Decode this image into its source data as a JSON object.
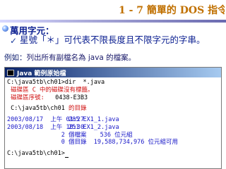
{
  "slide": {
    "title": "1 - 7   簡單的 DOS 指令",
    "heading": "萬用字元：",
    "sub_bullet": "✓",
    "sub_text": "星號「＊」可代表不限長度且不限字元的字串。",
    "example_label": "例如：",
    "example_text": "列出所有副檔名為  java  的檔案。"
  },
  "window": {
    "title": "Java 範例原始檔"
  },
  "console": {
    "cmd": "C:\\java5tb\\ch01>dir  *.java",
    "vol_note": " 磁碟區 C 中的磁碟沒有標籤。",
    "serial_label": " 磁碟區序號: ",
    "serial_value": "  0438-E3B3",
    "dir_path": " C:\\java5tb\\ch01",
    "dir_suffix": " 的目錄",
    "row1_date": "2003/08/17  上午 01:27",
    "row1_size": "                 285 EX1_1.java",
    "row2_date": "2003/08/18  上午 10:30",
    "row2_size": "                 251 EX1_2.java",
    "files_count": "               2 個檔案",
    "files_bytes": "              536 位元組",
    "dirs_count": "               0 個目錄  19,588,734,976 位元組可用",
    "prompt": "C:\\java5tb\\ch01>"
  }
}
